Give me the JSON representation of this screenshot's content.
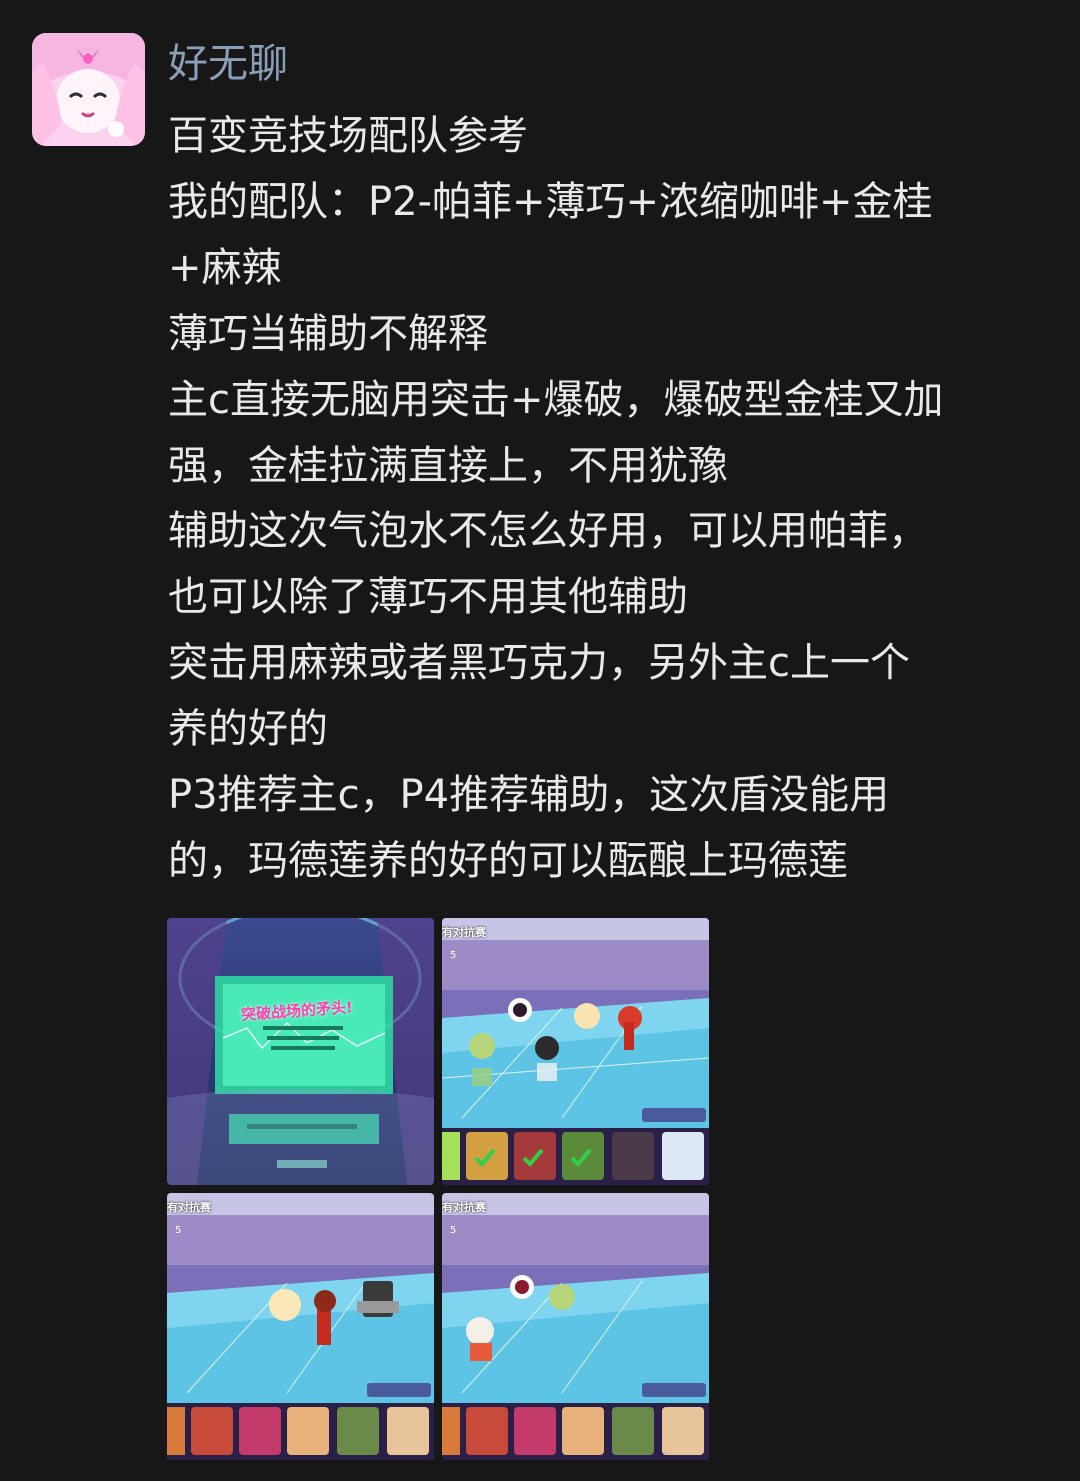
{
  "post": {
    "username": "好无聊",
    "lines": [
      "百变竞技场配队参考",
      "我的配队：P2-帕菲+薄巧+浓缩咖啡+金桂",
      "+麻辣",
      "薄巧当辅助不解释",
      "主c直接无脑用突击+爆破，爆破型金桂又加",
      "强，金桂拉满直接上，不用犹豫",
      "辅助这次气泡水不怎么好用，可以用帕菲，",
      "也可以除了薄巧不用其他辅助",
      "突击用麻辣或者黑巧克力，另外主c上一个",
      "养的好的",
      "P3推荐主c，P4推荐辅助，这次盾没能用",
      "的，玛德莲养的好的可以酝酿上玛德莲"
    ]
  },
  "images": [
    {
      "banner": "突破战场的矛头!"
    },
    {
      "title": "有对抗赛",
      "stage": "5"
    },
    {
      "title": "有对抗赛",
      "stage": "5"
    },
    {
      "title": "有对抗赛",
      "stage": "5"
    }
  ],
  "colors": {
    "background": "#171717",
    "username": "#8c9fb8",
    "text": "#e9e9e9"
  }
}
